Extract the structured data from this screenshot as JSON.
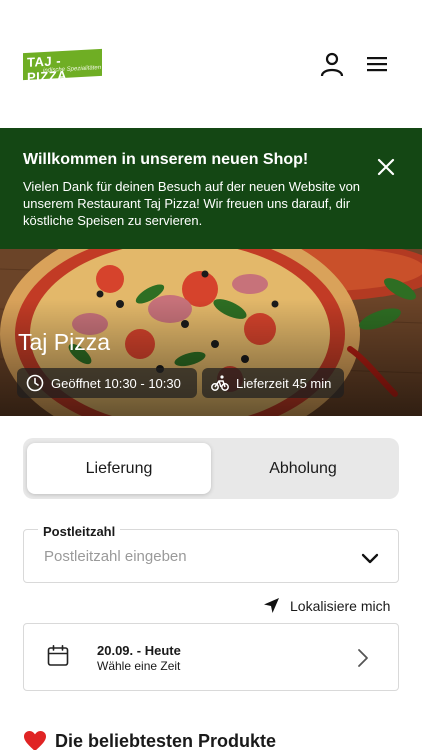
{
  "header": {
    "logo_text": "TAJ - PIZZA",
    "logo_subtext": "indische Spezialitäten",
    "icons": {
      "user": "user-icon",
      "menu": "hamburger-menu-icon"
    }
  },
  "banner": {
    "title": "Willkommen in unserem neuen Shop!",
    "text": "Vielen Dank für deinen Besuch auf der neuen Website von unserem Restaurant Taj Pizza! Wir freuen uns darauf, dir köstliche Speisen zu servieren.",
    "close_icon": "close-icon",
    "background": "#144714"
  },
  "hero": {
    "title": "Taj Pizza",
    "opening_hours": "Geöffnet 10:30 - 10:30",
    "delivery_time": "Lieferzeit 45 min"
  },
  "order_mode": {
    "options": [
      "Lieferung",
      "Abholung"
    ],
    "selected": "Lieferung"
  },
  "postal": {
    "label": "Postleitzahl",
    "placeholder": "Postleitzahl eingeben",
    "value": ""
  },
  "locate": {
    "label": "Lokalisiere mich"
  },
  "date": {
    "main": "20.09. - Heute",
    "sub": "Wähle eine Zeit"
  },
  "popular": {
    "title": "Die beliebtesten Produkte",
    "icon": "heart-icon"
  }
}
